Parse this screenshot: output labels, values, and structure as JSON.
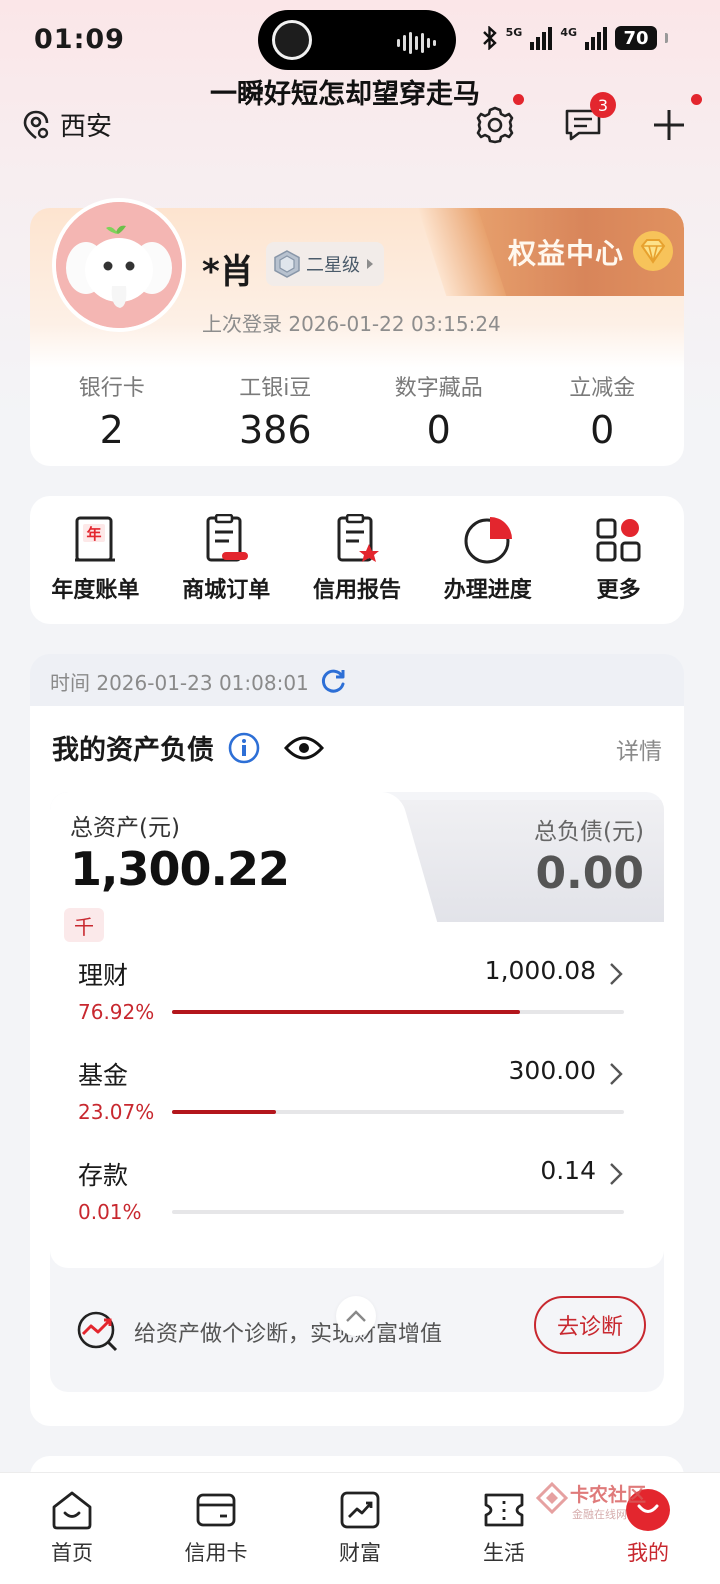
{
  "status_bar": {
    "time": "01:09",
    "network_1": "5G",
    "network_2": "4G",
    "battery": "70"
  },
  "marquee_text": "一瞬好短怎却望穿走马",
  "location": {
    "city": "西安"
  },
  "top_actions": {
    "messages_badge": "3"
  },
  "profile": {
    "name": "*肖",
    "level": "二星级",
    "last_login": "上次登录 2026-01-22 03:15:24",
    "rights_center": "权益中心",
    "stats": [
      {
        "label": "银行卡",
        "value": "2"
      },
      {
        "label": "工银i豆",
        "value": "386"
      },
      {
        "label": "数字藏品",
        "value": "0"
      },
      {
        "label": "立减金",
        "value": "0"
      }
    ]
  },
  "shortcuts": [
    {
      "label": "年度账单",
      "icon": "annual-bill-icon"
    },
    {
      "label": "商城订单",
      "icon": "mall-order-icon"
    },
    {
      "label": "信用报告",
      "icon": "credit-report-icon"
    },
    {
      "label": "办理进度",
      "icon": "progress-icon"
    },
    {
      "label": "更多",
      "icon": "more-grid-icon"
    }
  ],
  "assets": {
    "timestamp": "时间 2026-01-23 01:08:01",
    "title": "我的资产负债",
    "detail": "详情",
    "total_assets_label": "总资产(元)",
    "total_assets_value": "1,300.22",
    "unit_chip": "千",
    "total_debt_label": "总负债(元)",
    "total_debt_value": "0.00",
    "items": [
      {
        "name": "理财",
        "amount": "1,000.08",
        "percent": "76.92%",
        "ratio": 0.7692
      },
      {
        "name": "基金",
        "amount": "300.00",
        "percent": "23.07%",
        "ratio": 0.2307
      },
      {
        "name": "存款",
        "amount": "0.14",
        "percent": "0.01%",
        "ratio": 0.0001
      }
    ],
    "diagnose_text": "给资产做个诊断，实现财富增值",
    "diagnose_button": "去诊断"
  },
  "bottom_nav": [
    {
      "label": "首页",
      "active": false
    },
    {
      "label": "信用卡",
      "active": false
    },
    {
      "label": "财富",
      "active": false
    },
    {
      "label": "生活",
      "active": false
    },
    {
      "label": "我的",
      "active": true
    }
  ],
  "watermark": {
    "line1": "卡农社区",
    "line2": "金融在线网"
  },
  "colors": {
    "brand_red": "#c8282f",
    "badge_red": "#e3262e",
    "rights_gold": "#d8855a"
  }
}
